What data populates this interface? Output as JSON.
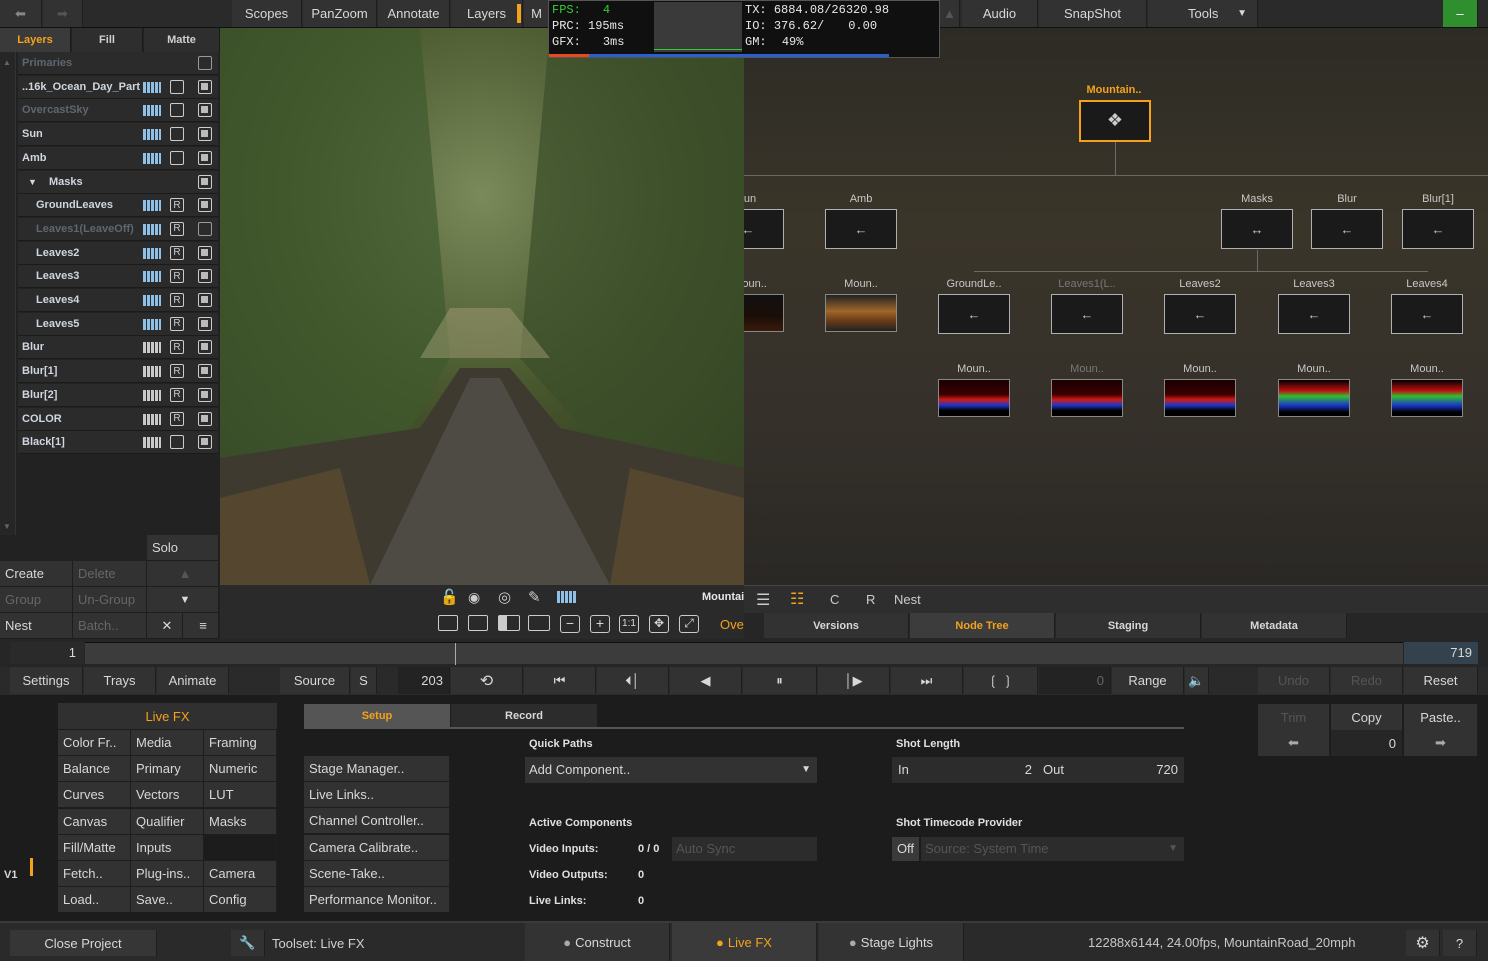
{
  "topbar": {
    "back_icon": "arrow-left-icon",
    "forward_icon": "arrow-right-icon",
    "tabs": [
      "Scopes",
      "PanZoom",
      "Annotate",
      "Layers",
      "M"
    ],
    "right_tabs": [
      "Audio",
      "SnapShot",
      "Tools"
    ],
    "minimize_label": "–"
  },
  "stats": {
    "fps_label": "FPS:",
    "fps_value": "4",
    "prc_label": "PRC:",
    "prc_value": "195ms",
    "gfx_label": "GFX:",
    "gfx_value": "3ms",
    "tx_label": "TX:",
    "tx_value": "6884.08/26320.98",
    "io_label": "IO:",
    "io_value": "376.62/",
    "io_value2": "0.00",
    "gm_label": "GM:",
    "gm_value": "49%"
  },
  "layers_panel": {
    "tabs": [
      "Layers",
      "Fill",
      "Matte"
    ],
    "rows": [
      {
        "label": "Primaries",
        "dim": true
      },
      {
        "label": "..16k_Ocean_Day_Part"
      },
      {
        "label": "OvercastSky",
        "dim": true
      },
      {
        "label": "Sun"
      },
      {
        "label": "Amb"
      },
      {
        "label": "Masks"
      },
      {
        "label": "GroundLeaves"
      },
      {
        "label": "Leaves1(LeaveOff)",
        "dim": true
      },
      {
        "label": "Leaves2"
      },
      {
        "label": "Leaves3"
      },
      {
        "label": "Leaves4"
      },
      {
        "label": "Leaves5"
      },
      {
        "label": "Blur"
      },
      {
        "label": "Blur[1]"
      },
      {
        "label": "Blur[2]"
      },
      {
        "label": "COLOR"
      },
      {
        "label": "Black[1]"
      }
    ],
    "solo": "Solo",
    "create": "Create",
    "delete": "Delete",
    "group": "Group",
    "ungroup": "Un-Group",
    "nest": "Nest",
    "batch": "Batch..",
    "r_glyph": "R"
  },
  "viewport_toolbar": {
    "name": "Mountai",
    "ove": "Ove",
    "one_to_one": "1:1"
  },
  "nodegraph": {
    "root": "Mountain..",
    "row1": [
      "un",
      "Amb",
      "Masks",
      "Blur",
      "Blur[1]"
    ],
    "row2": [
      "Moun..",
      "Moun..",
      "GroundLe..",
      "Leaves1(L..",
      "Leaves2",
      "Leaves3",
      "Leaves4"
    ],
    "row3": [
      "Moun..",
      "Moun..",
      "Moun..",
      "Moun..",
      "Moun.."
    ],
    "toolbar": {
      "c": "C",
      "r": "R",
      "nest": "Nest"
    },
    "tabs": [
      "Versions",
      "Node Tree",
      "Staging",
      "Metadata"
    ]
  },
  "timeline": {
    "start": "1",
    "end": "719",
    "current": "203",
    "tab_settings": "Settings",
    "tab_trays": "Trays",
    "tab_animate": "Animate",
    "source": "Source",
    "s": "S",
    "zero": "0",
    "range": "Range",
    "undo": "Undo",
    "redo": "Redo",
    "reset": "Reset"
  },
  "livefx": {
    "title": "Live FX",
    "grid": [
      [
        "Color Fr..",
        "Media",
        "Framing"
      ],
      [
        "Balance",
        "Primary",
        "Numeric"
      ],
      [
        "Curves",
        "Vectors",
        "LUT"
      ],
      [
        "Canvas",
        "Qualifier",
        "Masks"
      ],
      [
        "Fill/Matte",
        "Inputs",
        ""
      ],
      [
        "Fetch..",
        "Plug-ins..",
        "Camera"
      ],
      [
        "Load..",
        "Save..",
        "Config"
      ]
    ],
    "v1": "V1"
  },
  "setup": {
    "tabs": [
      "Setup",
      "Record"
    ],
    "links": [
      "Stage Manager..",
      "Live Links..",
      "Channel Controller..",
      "Camera Calibrate..",
      "Scene-Take..",
      "Performance Monitor.."
    ],
    "quick_paths": "Quick Paths",
    "add_component": "Add Component..",
    "active_components": "Active Components",
    "video_inputs": "Video Inputs:",
    "video_inputs_val": "0 / 0",
    "auto_sync": "Auto Sync",
    "video_outputs": "Video Outputs:",
    "video_outputs_val": "0",
    "live_links": "Live Links:",
    "live_links_val": "0",
    "shot_length": "Shot Length",
    "in": "In",
    "in_val": "2",
    "out": "Out",
    "out_val": "720",
    "timecode": "Shot Timecode Provider",
    "off": "Off",
    "source_time": "Source: System Time"
  },
  "clipboard": {
    "trim": "Trim",
    "copy": "Copy",
    "paste": "Paste..",
    "value": "0"
  },
  "statusbar": {
    "close": "Close Project",
    "toolset": "Toolset: Live FX",
    "construct": "Construct",
    "livefx": "Live FX",
    "stage_lights": "Stage Lights",
    "info": "12288x6144, 24.00fps, MountainRoad_20mph",
    "help": "?"
  },
  "colors": {
    "accent": "#f4a21c",
    "green": "#2f8f2f",
    "bars": "#8fc0e8"
  }
}
